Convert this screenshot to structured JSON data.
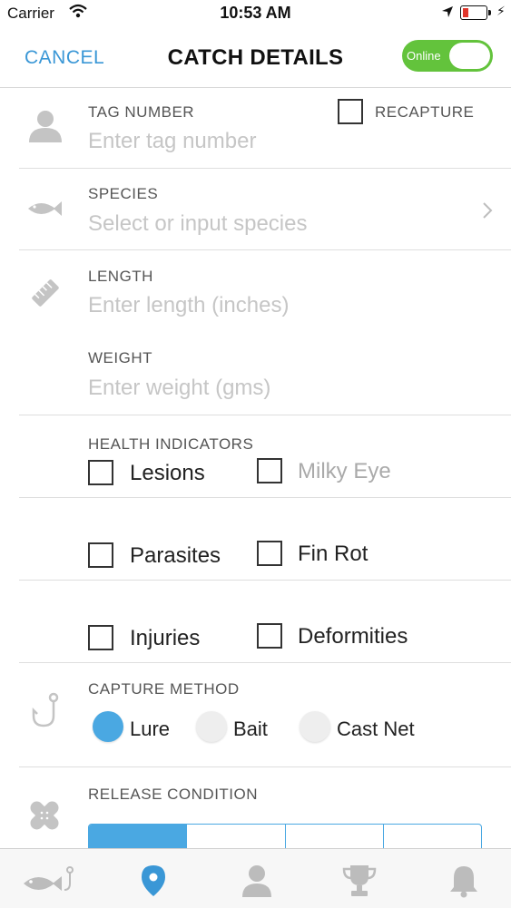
{
  "status": {
    "carrier": "Carrier",
    "time": "10:53 AM"
  },
  "nav": {
    "cancel": "CANCEL",
    "title": "CATCH DETAILS",
    "online_label": "Online",
    "online": true
  },
  "form": {
    "tag": {
      "label": "TAG NUMBER",
      "placeholder": "Enter tag number",
      "recapture_label": "RECAPTURE"
    },
    "species": {
      "label": "SPECIES",
      "placeholder": "Select or input species"
    },
    "length": {
      "label": "LENGTH",
      "placeholder": "Enter length (inches)"
    },
    "weight": {
      "label": "WEIGHT",
      "placeholder": "Enter weight (gms)"
    },
    "health": {
      "label": "HEALTH INDICATORS",
      "options": [
        "Lesions",
        "Milky Eye",
        "Parasites",
        "Fin Rot",
        "Injuries",
        "Deformities"
      ]
    },
    "capture": {
      "label": "CAPTURE METHOD",
      "options": [
        "Lure",
        "Bait",
        "Cast Net"
      ],
      "selected": "Lure"
    },
    "release": {
      "label": "RELEASE CONDITION"
    }
  },
  "colors": {
    "accent": "#3a97d6",
    "toggle_on": "#63c33c",
    "icon_gray": "#c4c4c4",
    "tab_active": "#3a97d6"
  },
  "tabbar": {
    "icons": [
      "fish-hook-icon",
      "location-pin-icon",
      "person-icon",
      "trophy-icon",
      "bell-icon"
    ],
    "active": "location-pin-icon"
  }
}
